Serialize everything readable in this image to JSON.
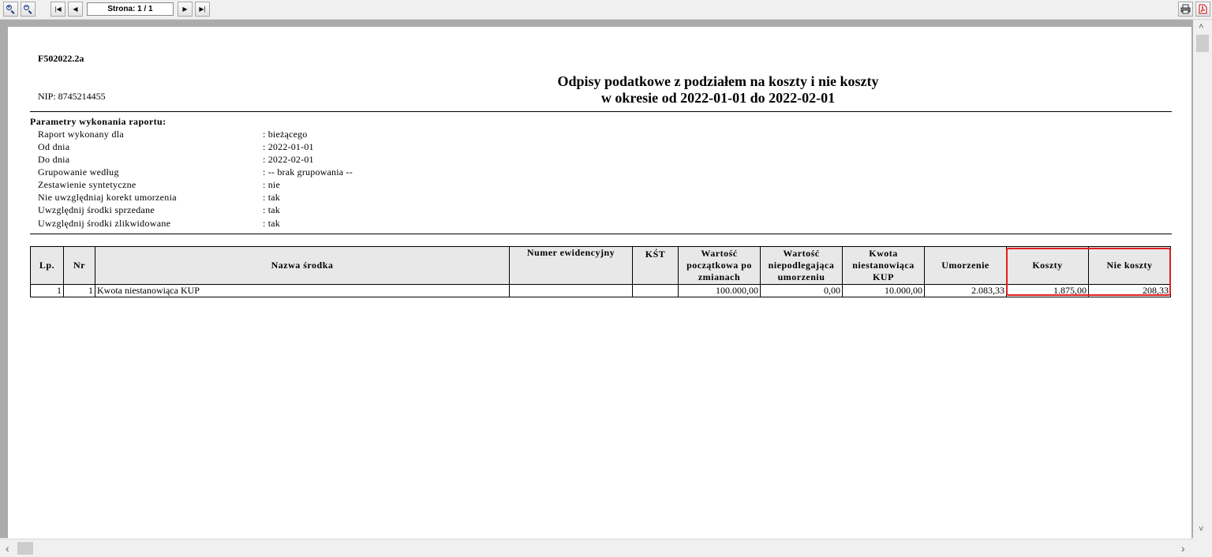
{
  "toolbar": {
    "page_indicator": "Strona: 1 / 1",
    "zoom_in_icon": "zoom-in-icon",
    "zoom_out_icon": "zoom-out-icon",
    "first_icon": "first-page-icon",
    "prev_icon": "prev-page-icon",
    "next_icon": "next-page-icon",
    "last_icon": "last-page-icon",
    "print_icon": "print-icon",
    "pdf_icon": "pdf-icon"
  },
  "report": {
    "code": "F502022.2a",
    "nip": "NIP: 8745214455",
    "title_line1": "Odpisy podatkowe z podziałem na koszty i nie koszty",
    "title_line2": "w okresie od 2022-01-01 do 2022-02-01",
    "params_header": "Parametry wykonania raportu:",
    "params": [
      {
        "label": "Raport wykonany dla",
        "value": ": bieżącego"
      },
      {
        "label": "Od dnia",
        "value": ": 2022-01-01"
      },
      {
        "label": "Do dnia",
        "value": ": 2022-02-01"
      },
      {
        "label": "Grupowanie według",
        "value": ": -- brak grupowania --"
      },
      {
        "label": "Zestawienie syntetyczne",
        "value": ": nie"
      },
      {
        "label": "Nie uwzględniaj korekt umorzenia",
        "value": ": tak"
      },
      {
        "label": "Uwzględnij środki sprzedane",
        "value": ": tak"
      },
      {
        "label": "Uwzględnij środki zlikwidowane",
        "value": ": tak"
      }
    ],
    "table": {
      "headers": [
        "Lp.",
        "Nr",
        "Nazwa środka",
        "Numer ewidencyjny",
        "KŚT",
        "Wartość początkowa po zmianach",
        "Wartość niepodlegająca umorzeniu",
        "Kwota niestanowiąca KUP",
        "Umorzenie",
        "Koszty",
        "Nie koszty"
      ],
      "rows": [
        [
          "1",
          "1",
          "Kwota niestanowiąca KUP",
          "",
          "",
          "100.000,00",
          "0,00",
          "10.000,00",
          "2.083,33",
          "1.875,00",
          "208,33"
        ]
      ]
    },
    "highlight_color": "#e02020"
  }
}
